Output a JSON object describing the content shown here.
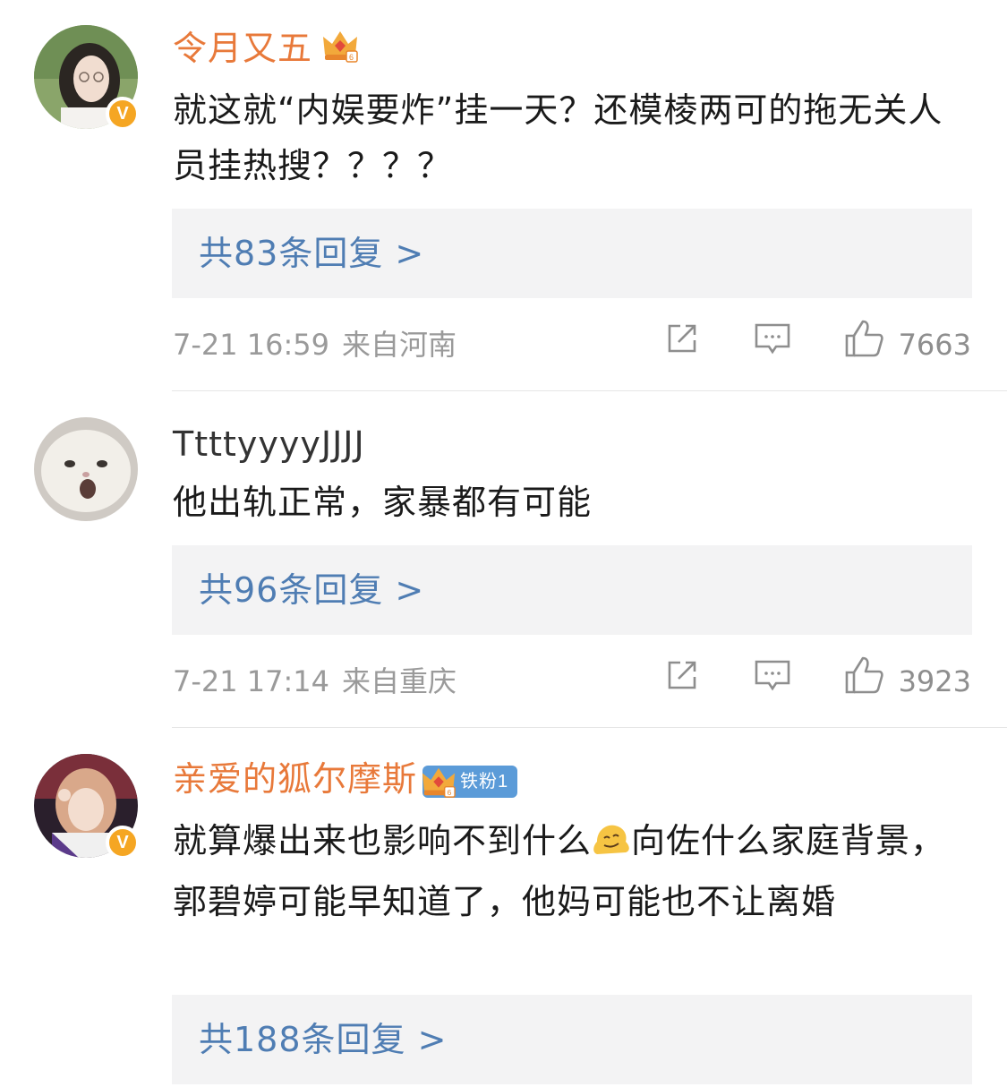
{
  "comments": [
    {
      "username": "令月又五",
      "text": "就这就“内娱要炸”挂一天？还模棱两可的拖无关人员挂热搜？？？？",
      "replies": "共83条回复 >",
      "time": "7-21 16:59",
      "location": "来自河南",
      "likes": "7663",
      "verified": "V"
    },
    {
      "username": "TtttyyyyJJJJ",
      "text": "他出轨正常，家暴都有可能",
      "replies": "共96条回复 >",
      "time": "7-21 17:14",
      "location": "来自重庆",
      "likes": "3923"
    },
    {
      "username": "亲爱的狐尔摩斯",
      "fan_badge": "铁粉1",
      "text_part1": "就算爆出来也影响不到什么",
      "emoji": "melting-face-emoji",
      "text_part2": "向佐什么家庭背景，郭碧婷可能早知道了，他妈可能也不让离婚",
      "replies": "共188条回复 >",
      "verified": "V"
    }
  ],
  "colors": {
    "vip_name": "#e8793a",
    "reply_link": "#4f7db3",
    "meta_gray": "#9a9a9a",
    "verified_badge": "#f5a623",
    "reply_bg": "#f3f3f4"
  }
}
